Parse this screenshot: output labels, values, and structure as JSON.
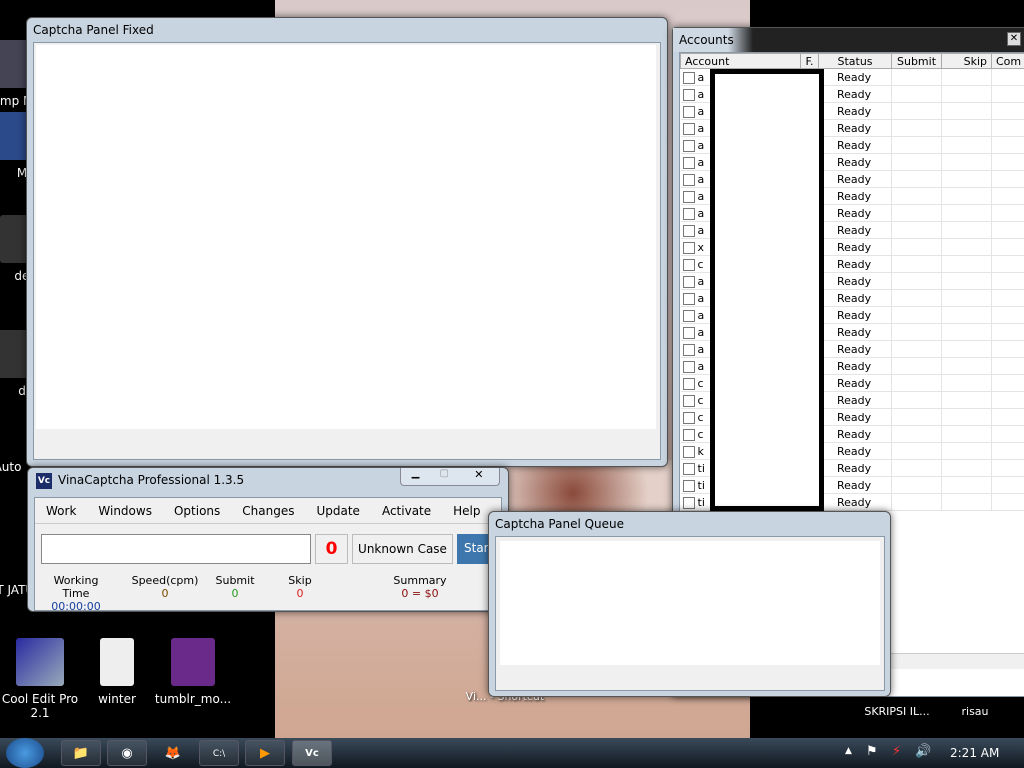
{
  "desktop_icons": [
    {
      "label": "Temp Meti"
    },
    {
      "label": "M"
    },
    {
      "label": "def"
    },
    {
      "label": "d"
    },
    {
      "label": "Auto"
    },
    {
      "label": "BAT JATU"
    },
    {
      "label": "Cool Edit Pro 2.1"
    },
    {
      "label": "winter"
    },
    {
      "label": "tumblr_mo..."
    },
    {
      "label": "Vi... - Shortcut"
    },
    {
      "label": "SKRIPSI IL..."
    },
    {
      "label": "risau"
    }
  ],
  "captcha_fixed": {
    "title": "Captcha Panel Fixed"
  },
  "main": {
    "title": "VinaCaptcha Professional 1.3.5",
    "logo": "Vc",
    "menu": [
      "Work",
      "Windows",
      "Options",
      "Changes",
      "Update",
      "Activate",
      "Help"
    ],
    "input_value": "",
    "counter": "0",
    "case_button": "Unknown Case",
    "start_button": "Start",
    "stats": [
      {
        "label": "Working Time",
        "value": "00:00:00",
        "color": "#1a3fa0"
      },
      {
        "label": "Speed(cpm)",
        "value": "0",
        "color": "#7a4a00"
      },
      {
        "label": "Submit",
        "value": "0",
        "color": "#2a9a20"
      },
      {
        "label": "Skip",
        "value": "0",
        "color": "#e02020"
      },
      {
        "label": "Summary",
        "value": "0 = $0",
        "color": "#8a1010"
      }
    ]
  },
  "accounts": {
    "title": "Accounts",
    "columns": [
      "Account",
      "F.",
      "Status",
      "Submit",
      "Skip",
      "Com"
    ],
    "rows": [
      {
        "account": "a",
        "status": "Ready"
      },
      {
        "account": "a",
        "status": "Ready"
      },
      {
        "account": "a",
        "status": "Ready"
      },
      {
        "account": "a",
        "status": "Ready"
      },
      {
        "account": "a",
        "status": "Ready"
      },
      {
        "account": "a",
        "status": "Ready"
      },
      {
        "account": "a",
        "status": "Ready"
      },
      {
        "account": "a",
        "status": "Ready"
      },
      {
        "account": "a",
        "status": "Ready"
      },
      {
        "account": "a",
        "status": "Ready"
      },
      {
        "account": "x",
        "status": "Ready"
      },
      {
        "account": "c",
        "status": "Ready"
      },
      {
        "account": "a",
        "status": "Ready"
      },
      {
        "account": "a",
        "status": "Ready"
      },
      {
        "account": "a",
        "status": "Ready"
      },
      {
        "account": "a",
        "status": "Ready"
      },
      {
        "account": "a",
        "status": "Ready"
      },
      {
        "account": "a",
        "status": "Ready"
      },
      {
        "account": "c",
        "status": "Ready"
      },
      {
        "account": "c",
        "status": "Ready"
      },
      {
        "account": "c",
        "status": "Ready"
      },
      {
        "account": "c",
        "status": "Ready"
      },
      {
        "account": "k",
        "status": "Ready"
      },
      {
        "account": "ti",
        "status": "Ready"
      },
      {
        "account": "ti",
        "status": "Ready"
      },
      {
        "account": "ti",
        "status": "Ready"
      }
    ]
  },
  "captcha_queue": {
    "title": "Captcha Panel Queue"
  },
  "taskbar": {
    "clock": "2:21 AM",
    "apps": [
      "explorer-icon",
      "chrome-icon",
      "firefox-icon",
      "cmd-icon",
      "media-player-icon",
      "vinacaptcha-icon"
    ]
  }
}
